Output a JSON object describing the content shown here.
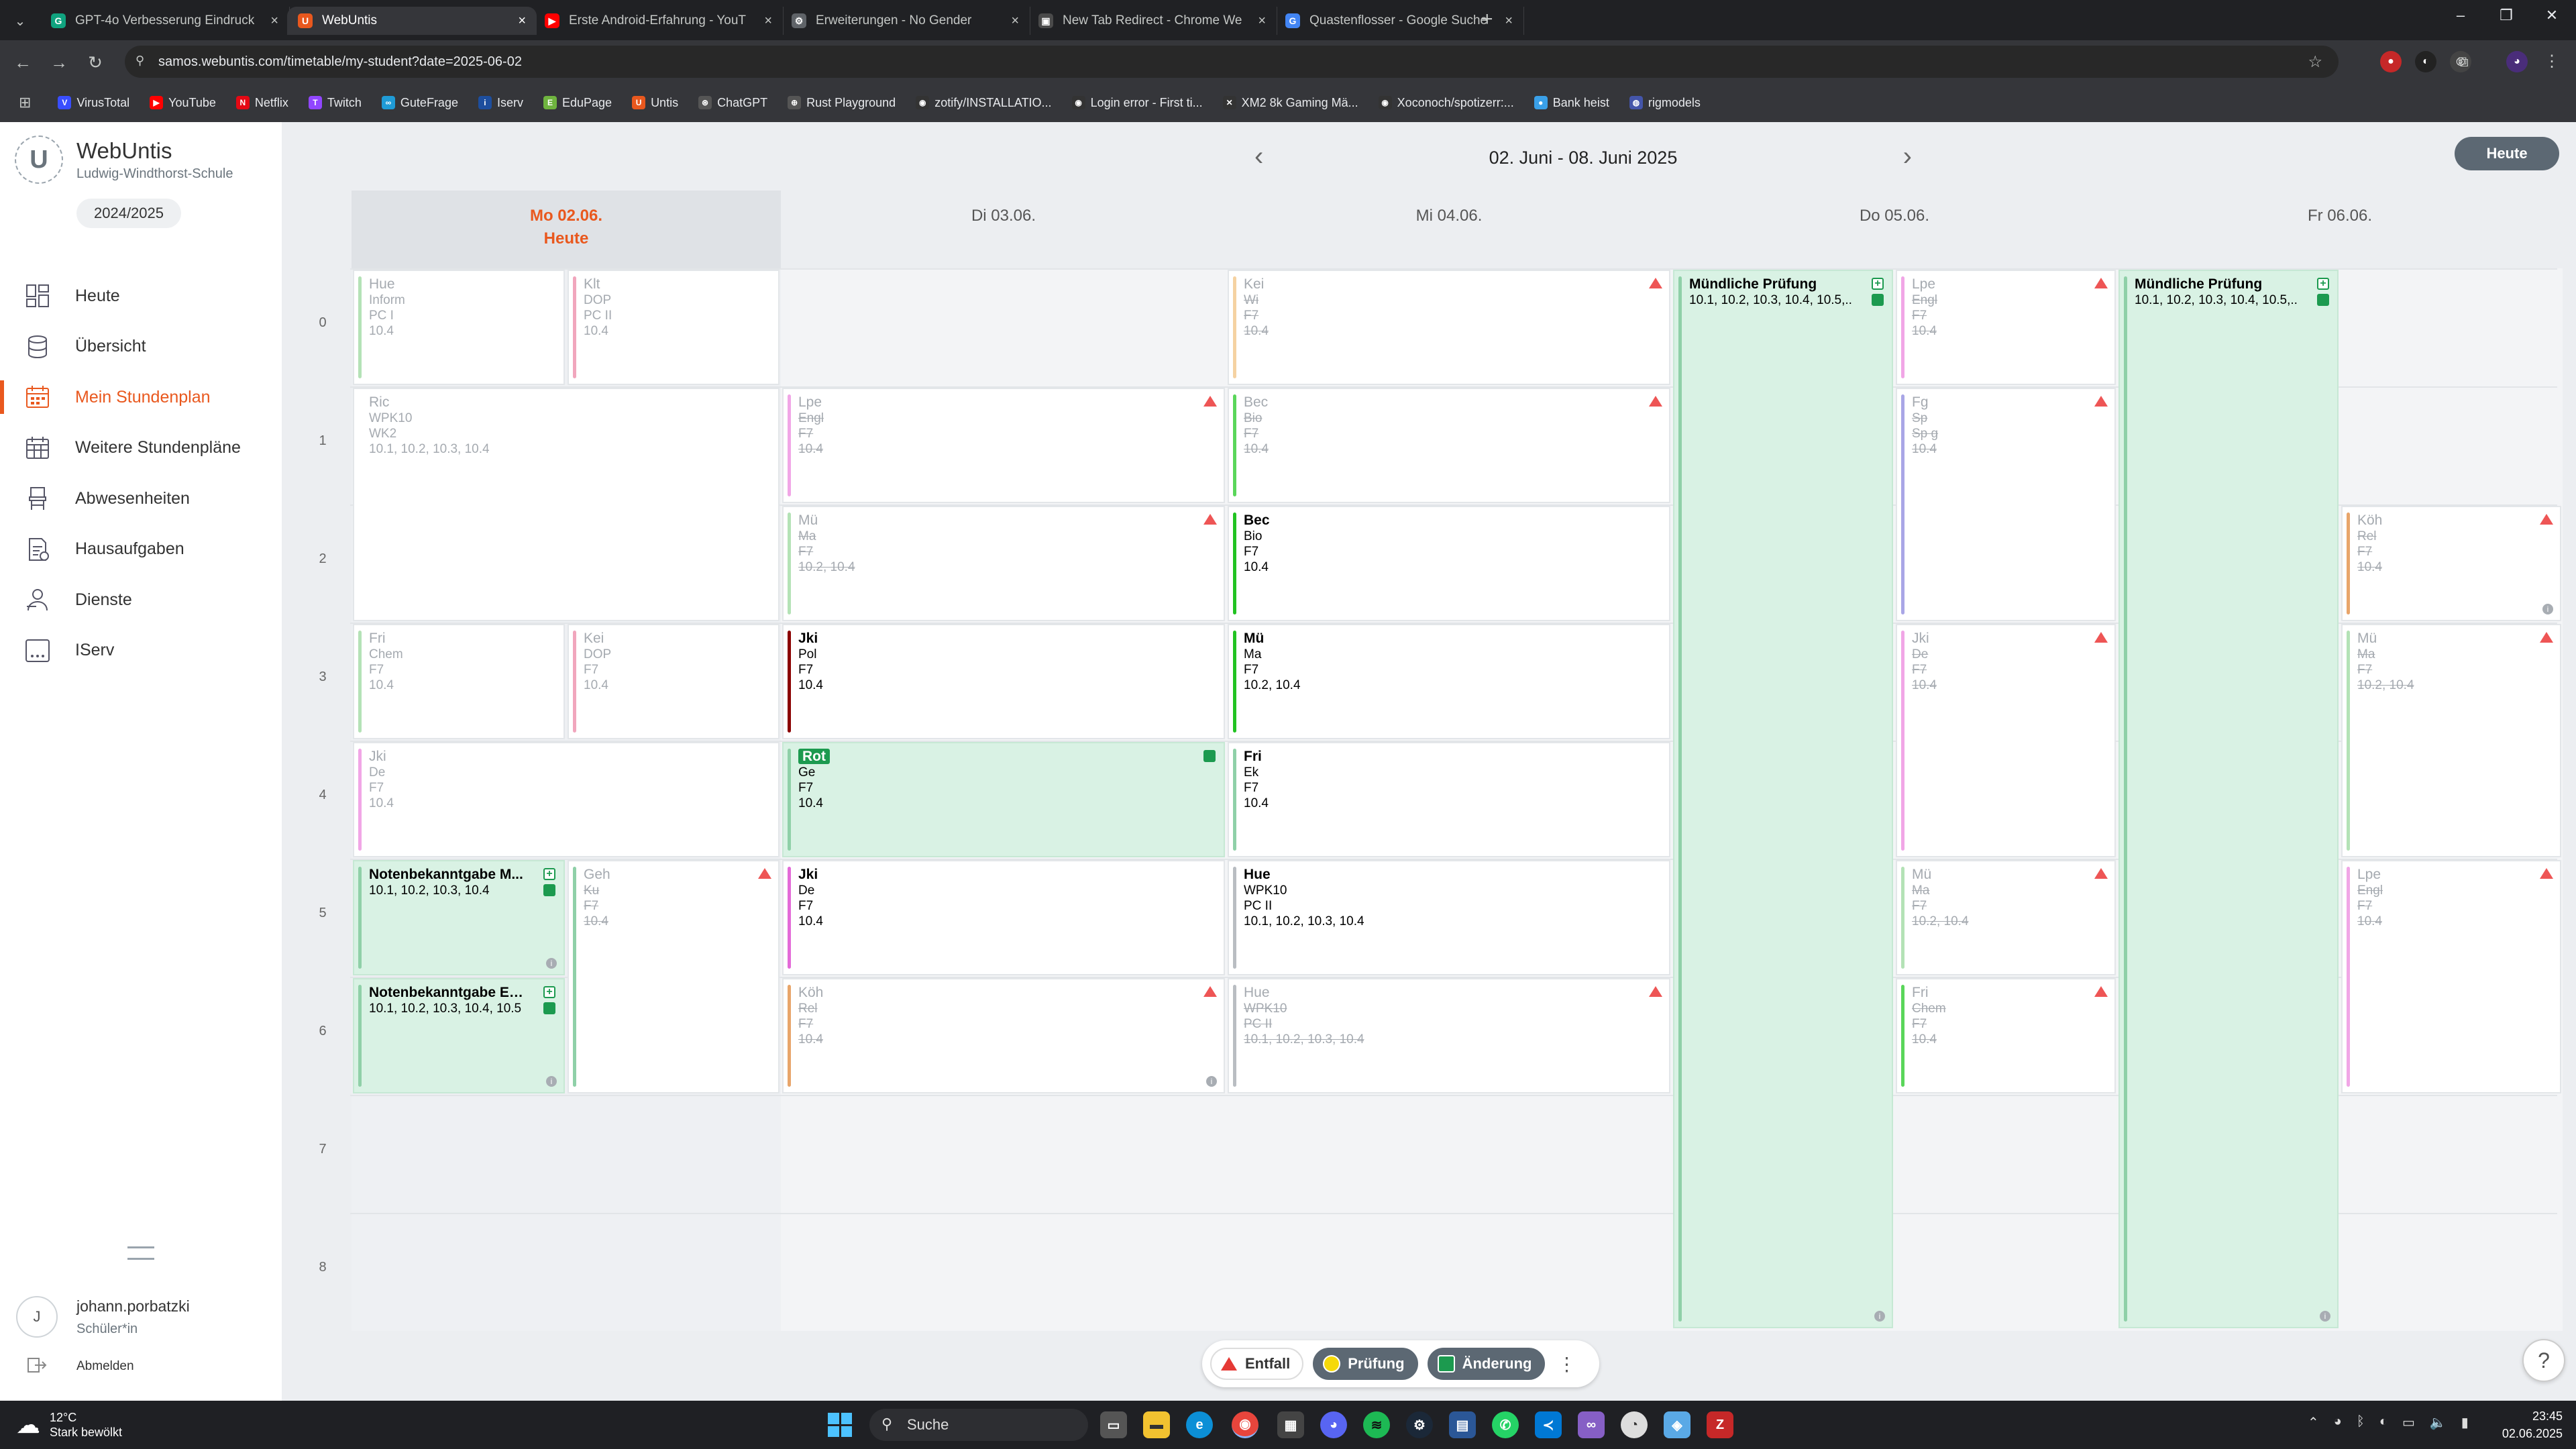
{
  "browser": {
    "tabs": [
      {
        "title": "GPT-4o Verbesserung Eindruck",
        "color": "#10a37f",
        "glyph": "G",
        "active": false
      },
      {
        "title": "WebUntis",
        "color": "#e9581e",
        "glyph": "U",
        "active": true
      },
      {
        "title": "Erste Android-Erfahrung - YouT",
        "color": "#ff0000",
        "glyph": "▶",
        "active": false
      },
      {
        "title": "Erweiterungen - No Gender",
        "color": "#5f6368",
        "glyph": "⚙",
        "active": false
      },
      {
        "title": "New Tab Redirect - Chrome We",
        "color": "#4a4a4a",
        "glyph": "▣",
        "active": false
      },
      {
        "title": "Quastenflosser - Google Suche",
        "color": "#4285f4",
        "glyph": "G",
        "active": false
      }
    ],
    "url": "samos.webuntis.com/timetable/my-student?date=2025-06-02",
    "bookmarks": [
      {
        "label": "VirusTotal",
        "color": "#394eff",
        "glyph": "V"
      },
      {
        "label": "YouTube",
        "color": "#ff0000",
        "glyph": "▶"
      },
      {
        "label": "Netflix",
        "color": "#e50914",
        "glyph": "N"
      },
      {
        "label": "Twitch",
        "color": "#9146ff",
        "glyph": "T"
      },
      {
        "label": "GuteFrage",
        "color": "#1f9bd6",
        "glyph": "∞"
      },
      {
        "label": "Iserv",
        "color": "#1d4e9e",
        "glyph": "i"
      },
      {
        "label": "EduPage",
        "color": "#6fb43f",
        "glyph": "E"
      },
      {
        "label": "Untis",
        "color": "#e9581e",
        "glyph": "U"
      },
      {
        "label": "ChatGPT",
        "color": "#555",
        "glyph": "⊛"
      },
      {
        "label": "Rust Playground",
        "color": "#555",
        "glyph": "⊕"
      },
      {
        "label": "zotify/INSTALLATIO...",
        "color": "#333",
        "glyph": "◉"
      },
      {
        "label": "Login error - First ti...",
        "color": "#333",
        "glyph": "◉"
      },
      {
        "label": "XM2 8k Gaming Mä...",
        "color": "#333",
        "glyph": "✕"
      },
      {
        "label": "Xoconoch/spotizerr:...",
        "color": "#333",
        "glyph": "◉"
      },
      {
        "label": "Bank heist",
        "color": "#3aa0e8",
        "glyph": "●"
      },
      {
        "label": "rigmodels",
        "color": "#4455aa",
        "glyph": "◍"
      }
    ]
  },
  "app": {
    "name": "WebUntis",
    "school": "Ludwig-Windthorst-Schule",
    "logo_letter": "U",
    "school_year": "2024/2025",
    "nav": [
      {
        "label": "Heute",
        "icon": "dashboard-icon",
        "active": false
      },
      {
        "label": "Übersicht",
        "icon": "database-icon",
        "active": false
      },
      {
        "label": "Mein Stundenplan",
        "icon": "calendar-icon",
        "active": true
      },
      {
        "label": "Weitere Stundenpläne",
        "icon": "calendar-grid-icon",
        "active": false
      },
      {
        "label": "Abwesenheiten",
        "icon": "chair-icon",
        "active": false
      },
      {
        "label": "Hausaufgaben",
        "icon": "homework-icon",
        "active": false
      },
      {
        "label": "Dienste",
        "icon": "person-service-icon",
        "active": false
      },
      {
        "label": "IServ",
        "icon": "iserv-icon",
        "active": false
      }
    ],
    "user": {
      "initial": "J",
      "name": "johann.porbatzki",
      "role": "Schüler*in",
      "logout": "Abmelden"
    }
  },
  "timetable": {
    "week_label": "02. Juni - 08. Juni 2025",
    "today_button": "Heute",
    "days": [
      {
        "label": "Mo 02.06.",
        "sub": "Heute",
        "today": true
      },
      {
        "label": "Di 03.06.",
        "sub": "",
        "today": false
      },
      {
        "label": "Mi 04.06.",
        "sub": "",
        "today": false
      },
      {
        "label": "Do 05.06.",
        "sub": "",
        "today": false
      },
      {
        "label": "Fr 06.06.",
        "sub": "",
        "today": false
      }
    ],
    "periods": [
      "0",
      "1",
      "2",
      "3",
      "4",
      "5",
      "6",
      "7",
      "8"
    ],
    "lessons": [
      {
        "day": 0,
        "sub": 0,
        "subs": 2,
        "start": 0,
        "span": 1,
        "style": "dim",
        "bar": "#b4e2b6",
        "lines": [
          "Hue",
          "Inform",
          "PC I",
          "10.4"
        ]
      },
      {
        "day": 0,
        "sub": 1,
        "subs": 2,
        "start": 0,
        "span": 1,
        "style": "dim",
        "bar": "#f1a6bd",
        "lines": [
          "Klt",
          "DOP",
          "PC II",
          "10.4"
        ]
      },
      {
        "day": 0,
        "sub": 0,
        "subs": 1,
        "start": 1,
        "span": 2,
        "style": "dim",
        "bar": "",
        "lines": [
          "Ric",
          "WPK10",
          "WK2",
          "10.1, 10.2, 10.3, 10.4"
        ]
      },
      {
        "day": 0,
        "sub": 0,
        "subs": 2,
        "start": 3,
        "span": 1,
        "style": "dim",
        "bar": "#b4e2b6",
        "lines": [
          "Fri",
          "Chem",
          "F7",
          "10.4"
        ]
      },
      {
        "day": 0,
        "sub": 1,
        "subs": 2,
        "start": 3,
        "span": 1,
        "style": "dim",
        "bar": "#f1a6bd",
        "lines": [
          "Kei",
          "DOP",
          "F7",
          "10.4"
        ]
      },
      {
        "day": 0,
        "sub": 0,
        "subs": 1,
        "start": 4,
        "span": 1,
        "style": "dim",
        "bar": "#f1a6e6",
        "lines": [
          "Jki",
          "De",
          "F7",
          "10.4"
        ]
      },
      {
        "day": 0,
        "sub": 0,
        "subs": 2,
        "start": 5,
        "span": 1,
        "style": "green",
        "bar": "#8fd0a8",
        "lines": [
          "Notenbekanntgabe M...",
          "10.1, 10.2, 10.3, 10.4",
          "",
          ""
        ],
        "plus": true,
        "square": true,
        "info": true
      },
      {
        "day": 0,
        "sub": 0,
        "subs": 2,
        "start": 6,
        "span": 1,
        "style": "green",
        "bar": "#8fd0a8",
        "lines": [
          "Notenbekanntgabe En...",
          "10.1, 10.2, 10.3, 10.4, 10.5",
          "",
          ""
        ],
        "plus": true,
        "square": true,
        "info": true
      },
      {
        "day": 0,
        "sub": 1,
        "subs": 2,
        "start": 5,
        "span": 2,
        "style": "cancel",
        "bar": "#8fd0a8",
        "lines": [
          "Geh",
          "Ku",
          "F7",
          "10.4"
        ],
        "warn": true
      },
      {
        "day": 1,
        "sub": 0,
        "subs": 1,
        "start": 1,
        "span": 1,
        "style": "cancel",
        "bar": "#f1a6e6",
        "lines": [
          "Lpe",
          "Engl",
          "F7",
          "10.4"
        ],
        "warn": true
      },
      {
        "day": 1,
        "sub": 0,
        "subs": 1,
        "start": 2,
        "span": 1,
        "style": "cancel",
        "bar": "#b4e2b6",
        "lines": [
          "Mü",
          "Ma",
          "F7",
          "10.2, 10.4"
        ],
        "warn": true
      },
      {
        "day": 1,
        "sub": 0,
        "subs": 1,
        "start": 3,
        "span": 1,
        "style": "normal",
        "bar": "#8b0000",
        "lines": [
          "Jki",
          "Pol",
          "F7",
          "10.4"
        ]
      },
      {
        "day": 1,
        "sub": 0,
        "subs": 1,
        "start": 4,
        "span": 1,
        "style": "green",
        "bar": "#8fd0a8",
        "lines": [
          "Rot",
          "Ge",
          "F7",
          "10.4"
        ],
        "square": true,
        "tag": true
      },
      {
        "day": 1,
        "sub": 0,
        "subs": 1,
        "start": 5,
        "span": 1,
        "style": "normal",
        "bar": "#e36ad8",
        "lines": [
          "Jki",
          "De",
          "F7",
          "10.4"
        ]
      },
      {
        "day": 1,
        "sub": 0,
        "subs": 1,
        "start": 6,
        "span": 1,
        "style": "cancel",
        "bar": "#e8a56a",
        "lines": [
          "Köh",
          "Rel",
          "F7",
          "10.4"
        ],
        "warn": true,
        "info": true
      },
      {
        "day": 2,
        "sub": 0,
        "subs": 1,
        "start": 0,
        "span": 1,
        "style": "cancel",
        "bar": "#f5d2a2",
        "lines": [
          "Kei",
          "Wi",
          "F7",
          "10.4"
        ],
        "warn": true
      },
      {
        "day": 2,
        "sub": 0,
        "subs": 1,
        "start": 1,
        "span": 1,
        "style": "cancel",
        "bar": "#5ad65a",
        "lines": [
          "Bec",
          "Bio",
          "F7",
          "10.4"
        ],
        "warn": true
      },
      {
        "day": 2,
        "sub": 0,
        "subs": 1,
        "start": 2,
        "span": 1,
        "style": "normal",
        "bar": "#22c322",
        "lines": [
          "Bec",
          "Bio",
          "F7",
          "10.4"
        ]
      },
      {
        "day": 2,
        "sub": 0,
        "subs": 1,
        "start": 3,
        "span": 1,
        "style": "normal",
        "bar": "#22c322",
        "lines": [
          "Mü",
          "Ma",
          "F7",
          "10.2, 10.4"
        ]
      },
      {
        "day": 2,
        "sub": 0,
        "subs": 1,
        "start": 4,
        "span": 1,
        "style": "normal",
        "bar": "#8fd0a8",
        "lines": [
          "Fri",
          "Ek",
          "F7",
          "10.4"
        ]
      },
      {
        "day": 2,
        "sub": 0,
        "subs": 1,
        "start": 5,
        "span": 1,
        "style": "normal",
        "bar": "#b9bdc2",
        "lines": [
          "Hue",
          "WPK10",
          "PC II",
          "10.1, 10.2, 10.3, 10.4"
        ]
      },
      {
        "day": 2,
        "sub": 0,
        "subs": 1,
        "start": 6,
        "span": 1,
        "style": "cancel",
        "bar": "#b9bdc2",
        "lines": [
          "Hue",
          "WPK10",
          "PC II",
          "10.1, 10.2, 10.3, 10.4"
        ],
        "warn": true
      },
      {
        "day": 3,
        "sub": 0,
        "subs": 2,
        "start": 0,
        "span": 9,
        "style": "green",
        "bar": "#8fd0a8",
        "lines": [
          "Mündliche Prüfung",
          "10.1, 10.2, 10.3, 10.4, 10.5,...",
          "",
          ""
        ],
        "plus": true,
        "square": true,
        "info": true
      },
      {
        "day": 3,
        "sub": 1,
        "subs": 2,
        "start": 0,
        "span": 1,
        "style": "cancel",
        "bar": "#f1a6e6",
        "lines": [
          "Lpe",
          "Engl",
          "F7",
          "10.4"
        ],
        "warn": true
      },
      {
        "day": 3,
        "sub": 1,
        "subs": 2,
        "start": 1,
        "span": 2,
        "style": "cancel",
        "bar": "#a9a6e6",
        "lines": [
          "Fg",
          "Sp",
          "Sp g",
          "10.4"
        ],
        "warn": true
      },
      {
        "day": 3,
        "sub": 1,
        "subs": 2,
        "start": 3,
        "span": 2,
        "style": "cancel",
        "bar": "#f1a6e6",
        "lines": [
          "Jki",
          "De",
          "F7",
          "10.4"
        ],
        "warn": true
      },
      {
        "day": 3,
        "sub": 1,
        "subs": 2,
        "start": 5,
        "span": 1,
        "style": "cancel",
        "bar": "#b4e2b6",
        "lines": [
          "Mü",
          "Ma",
          "F7",
          "10.2, 10.4"
        ],
        "warn": true
      },
      {
        "day": 3,
        "sub": 1,
        "subs": 2,
        "start": 6,
        "span": 1,
        "style": "cancel",
        "bar": "#5ad65a",
        "lines": [
          "Fri",
          "Chem",
          "F7",
          "10.4"
        ],
        "warn": true
      },
      {
        "day": 4,
        "sub": 0,
        "subs": 2,
        "start": 0,
        "span": 9,
        "style": "green",
        "bar": "#8fd0a8",
        "lines": [
          "Mündliche Prüfung",
          "10.1, 10.2, 10.3, 10.4, 10.5,...",
          "",
          ""
        ],
        "plus": true,
        "square": true,
        "info": true
      },
      {
        "day": 4,
        "sub": 1,
        "subs": 2,
        "start": 2,
        "span": 1,
        "style": "cancel",
        "bar": "#e8a56a",
        "lines": [
          "Köh",
          "Rel",
          "F7",
          "10.4"
        ],
        "warn": true,
        "info": true
      },
      {
        "day": 4,
        "sub": 1,
        "subs": 2,
        "start": 3,
        "span": 2,
        "style": "cancel",
        "bar": "#b4e2b6",
        "lines": [
          "Mü",
          "Ma",
          "F7",
          "10.2, 10.4"
        ],
        "warn": true
      },
      {
        "day": 4,
        "sub": 1,
        "subs": 2,
        "start": 5,
        "span": 2,
        "style": "cancel",
        "bar": "#f1a6e6",
        "lines": [
          "Lpe",
          "Engl",
          "F7",
          "10.4"
        ],
        "warn": true
      }
    ],
    "legend": {
      "cancel": "Entfall",
      "exam": "Prüfung",
      "change": "Änderung"
    }
  },
  "taskbar": {
    "weather_temp": "12°C",
    "weather_desc": "Stark bewölkt",
    "search_placeholder": "Suche",
    "time": "23:45",
    "date": "02.06.2025"
  }
}
